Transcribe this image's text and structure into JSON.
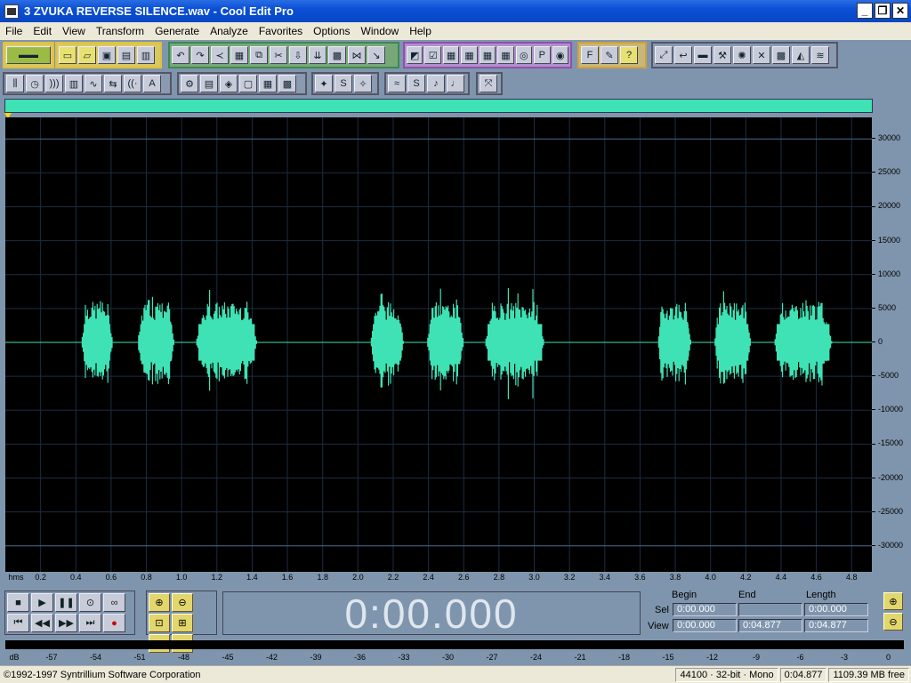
{
  "window": {
    "title": "3 ZVUKA REVERSE SILENCE.wav - Cool Edit Pro"
  },
  "menu": [
    "File",
    "Edit",
    "View",
    "Transform",
    "Generate",
    "Analyze",
    "Favorites",
    "Options",
    "Window",
    "Help"
  ],
  "colors": {
    "waveform": "#3fe2b4",
    "background": "#000000",
    "panel": "#7f95ad"
  },
  "waveform": {
    "x_unit": "hms",
    "x_ticks": [
      "0.2",
      "0.4",
      "0.6",
      "0.8",
      "1.0",
      "1.2",
      "1.4",
      "1.6",
      "1.8",
      "2.0",
      "2.2",
      "2.4",
      "2.6",
      "2.8",
      "3.0",
      "3.2",
      "3.4",
      "3.6",
      "3.8",
      "4.0",
      "4.2",
      "4.4",
      "4.6",
      "4.8"
    ],
    "y_ticks": [
      "30000",
      "25000",
      "20000",
      "15000",
      "10000",
      "5000",
      "0",
      "-5000",
      "-10000",
      "-15000",
      "-20000",
      "-25000",
      "-30000"
    ],
    "duration_s": 4.877,
    "bursts": [
      {
        "start": 0.43,
        "end": 0.61
      },
      {
        "start": 0.75,
        "end": 0.96
      },
      {
        "start": 1.08,
        "end": 1.43
      },
      {
        "start": 2.07,
        "end": 2.26
      },
      {
        "start": 2.39,
        "end": 2.6
      },
      {
        "start": 2.72,
        "end": 3.06
      },
      {
        "start": 3.7,
        "end": 3.89
      },
      {
        "start": 4.02,
        "end": 4.23
      },
      {
        "start": 4.36,
        "end": 4.69
      }
    ],
    "amplitude": 6000
  },
  "transport": {
    "time": "0:00.000"
  },
  "selection": {
    "headers": {
      "begin": "Begin",
      "end": "End",
      "length": "Length"
    },
    "sel": {
      "label": "Sel",
      "begin": "0:00.000",
      "end": "",
      "length": "0:00.000"
    },
    "view": {
      "label": "View",
      "begin": "0:00.000",
      "end": "0:04.877",
      "length": "0:04.877"
    }
  },
  "meter": {
    "ticks": [
      "dB",
      "-57",
      "-54",
      "-51",
      "-48",
      "-45",
      "-42",
      "-39",
      "-36",
      "-33",
      "-30",
      "-27",
      "-24",
      "-21",
      "-18",
      "-15",
      "-12",
      "-9",
      "-6",
      "-3",
      "0"
    ]
  },
  "status": {
    "copyright": "©1992-1997 Syntrillium Software Corporation",
    "format": "44100 · 32-bit · Mono",
    "length": "0:04.877",
    "free": "1109.39 MB free"
  }
}
